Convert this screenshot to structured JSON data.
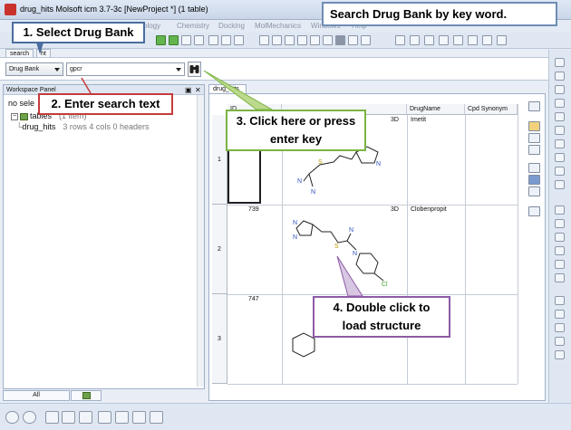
{
  "window": {
    "title": "drug_hits Molsoft icm 3.7-3c  [NewProject *] (1 table)"
  },
  "menu": {
    "items": [
      "ology",
      "Chemistry",
      "Docking",
      "MolMechanics",
      "Windows",
      "Help"
    ]
  },
  "tabs": {
    "search": "search",
    "other": "ht"
  },
  "search": {
    "database": "Drug Bank",
    "query": "gpcr"
  },
  "workspace": {
    "header": "Workspace Panel",
    "no_selection": "no sele",
    "tree": [
      {
        "label": "tables",
        "info": "(1 item)"
      },
      {
        "label": "drug_hits",
        "info": "3 rows 4 cols 0 headers"
      }
    ],
    "bottom_tabs": [
      "All"
    ]
  },
  "document": {
    "tab": "drug_hits",
    "columns": [
      "ID",
      "",
      "DrugName",
      "Cpd Synonym"
    ],
    "rows": [
      {
        "index": "1",
        "id": "",
        "dim": "3D",
        "name": "Imetit"
      },
      {
        "index": "2",
        "id": "739",
        "dim": "3D",
        "name": "Clobenpropit"
      },
      {
        "index": "3",
        "id": "747",
        "dim": "",
        "name": ""
      }
    ]
  },
  "callouts": {
    "title": "Search Drug Bank by key word.",
    "step1": "1. Select Drug Bank",
    "step2": "2. Enter search text",
    "step3_line1": "3. Click here or press",
    "step3_line2": "enter key",
    "step4_line1": "4. Double click to",
    "step4_line2": "load structure"
  },
  "atoms": {
    "n": "N",
    "s": "S",
    "cl": "Cl"
  },
  "colors": {
    "title_callout_border": "#6f8db5",
    "step1_border": "#4b6d9f",
    "step2_border": "#c43c3c",
    "step3_border": "#7bb342",
    "step4_border": "#8d5ba6",
    "nitrogen": "#2f4fbf",
    "sulfur": "#b89b00",
    "chlorine": "#39a827"
  }
}
